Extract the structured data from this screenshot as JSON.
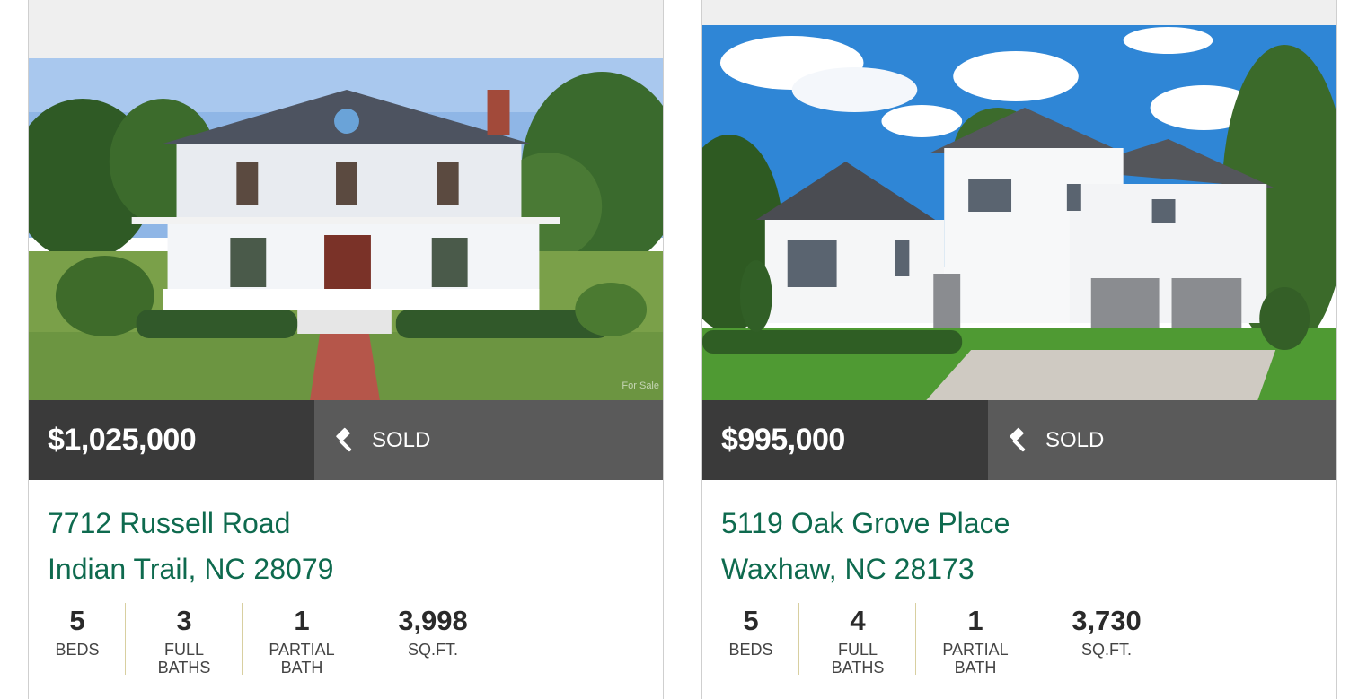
{
  "listings": [
    {
      "price": "$1,025,000",
      "status": "SOLD",
      "status_icon": "gavel-icon",
      "address_line1": "7712 Russell Road",
      "address_line2": "Indian Trail, NC 28079",
      "beds": "5",
      "beds_label": "BEDS",
      "full_baths": "3",
      "full_baths_label_1": "FULL",
      "full_baths_label_2": "BATHS",
      "partial_bath": "1",
      "partial_bath_label_1": "PARTIAL",
      "partial_bath_label_2": "BATH",
      "sqft": "3,998",
      "sqft_label": "SQ.FT.",
      "watermark": "For Sale"
    },
    {
      "price": "$995,000",
      "status": "SOLD",
      "status_icon": "gavel-icon",
      "address_line1": "5119 Oak Grove Place",
      "address_line2": "Waxhaw, NC 28173",
      "beds": "5",
      "beds_label": "BEDS",
      "full_baths": "4",
      "full_baths_label_1": "FULL",
      "full_baths_label_2": "BATHS",
      "partial_bath": "1",
      "partial_bath_label_1": "PARTIAL",
      "partial_bath_label_2": "BATH",
      "sqft": "3,730",
      "sqft_label": "SQ.FT."
    }
  ],
  "colors": {
    "address_green": "#0e6a4e",
    "price_bg": "#3a3a3a",
    "status_bg": "#5a5a5a",
    "separator": "#d8cfa0"
  }
}
